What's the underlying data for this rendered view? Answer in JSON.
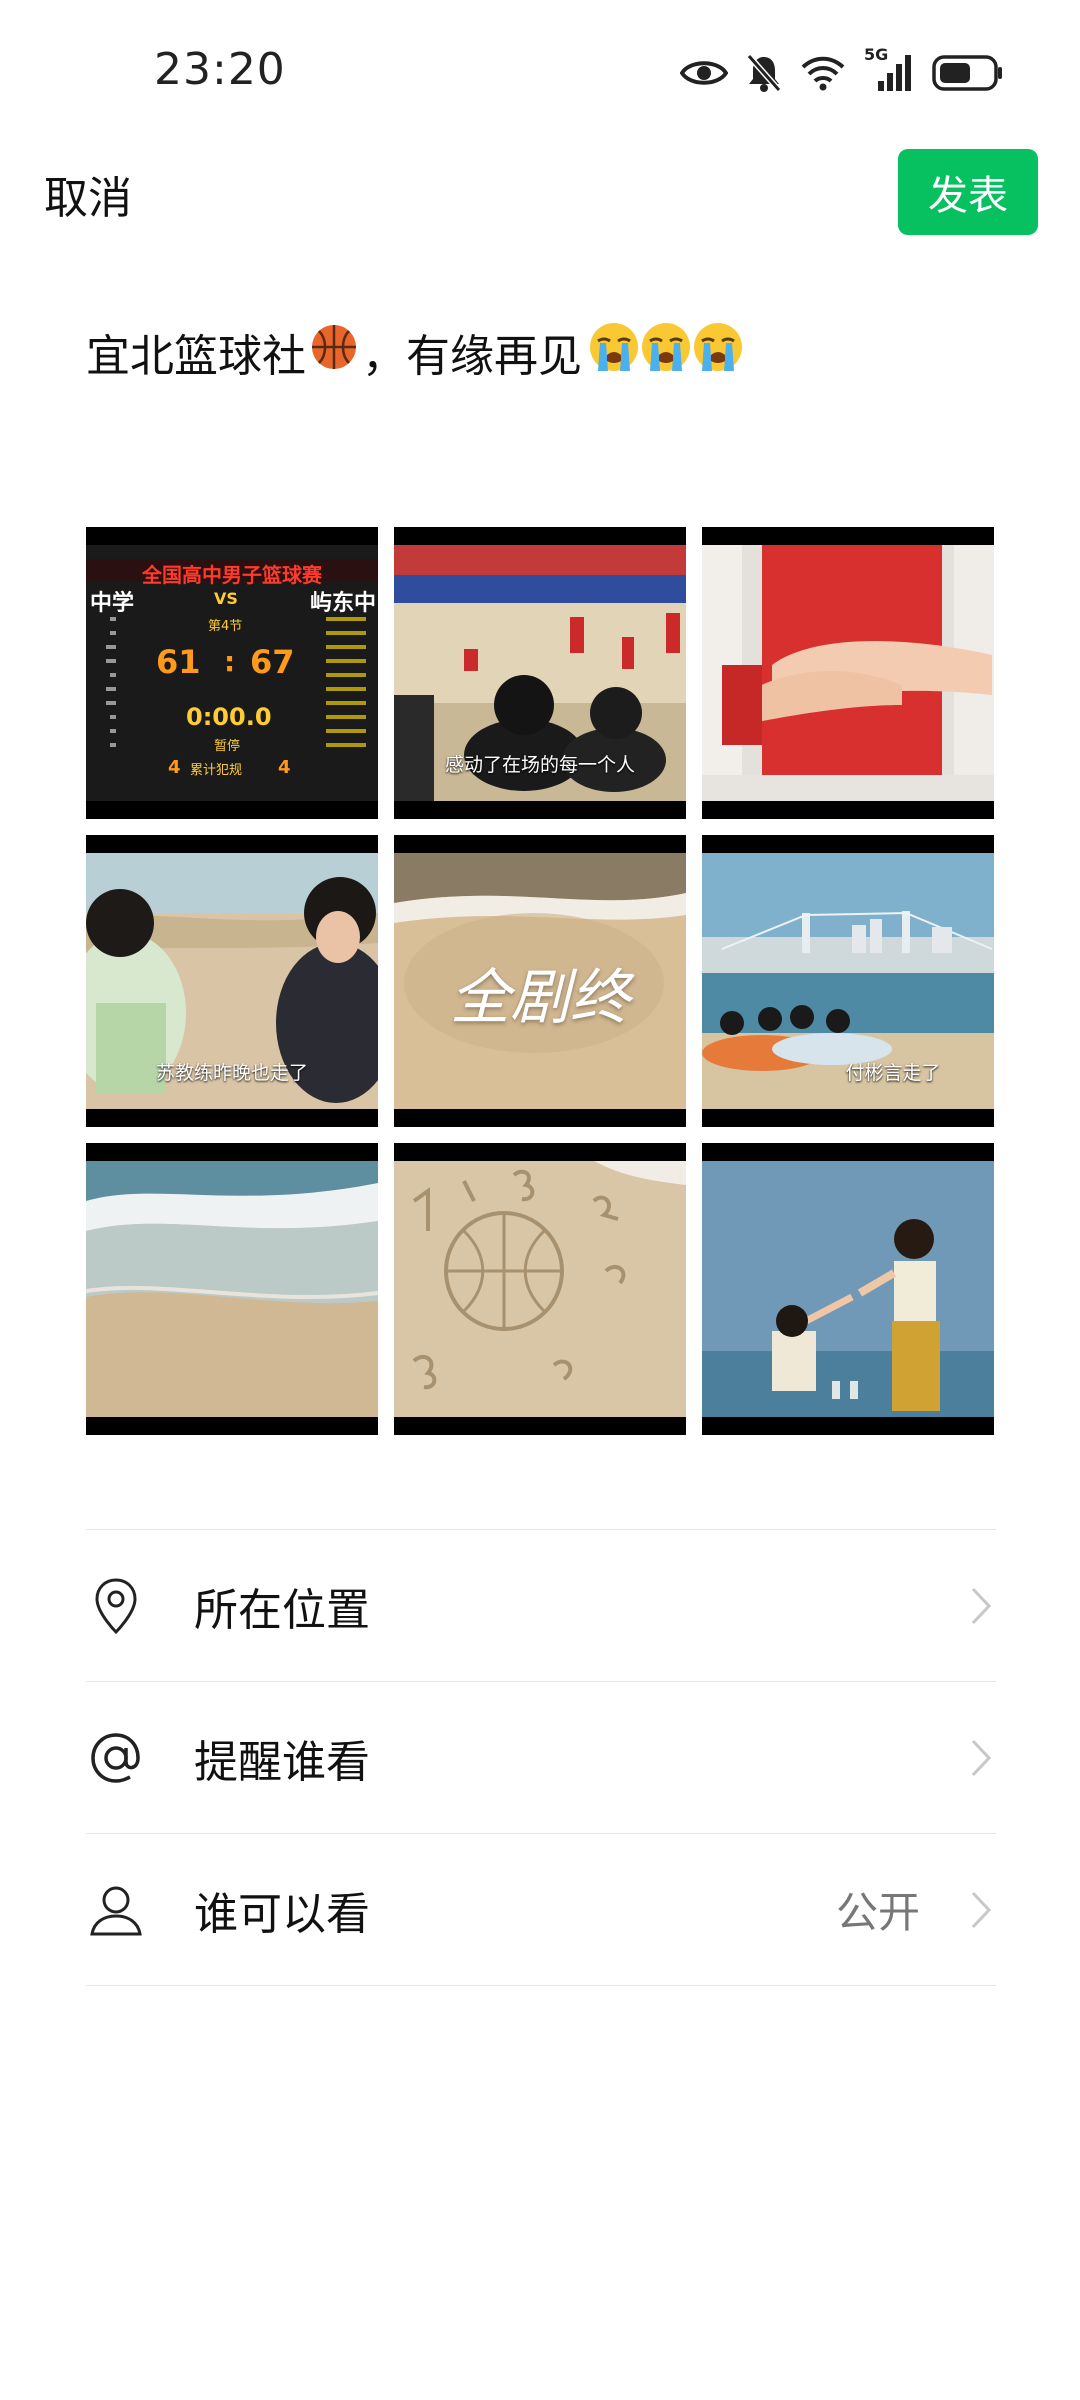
{
  "status_bar": {
    "time": "23:20",
    "network": "5G",
    "icons": [
      "eye-icon",
      "mute-bell-icon",
      "wifi-icon",
      "signal-icon",
      "battery-icon"
    ]
  },
  "header": {
    "cancel_label": "取消",
    "publish_label": "发表"
  },
  "post": {
    "text": "宜北篮球社",
    "text_after_ball": "，有缘再见"
  },
  "photos": [
    {
      "scoreboard_title": "全国高中男子篮球赛",
      "team_left": "中学",
      "vs": "VS",
      "team_right": "屿东中",
      "period": "第4节",
      "score_left": "61",
      "score_sep": ":",
      "score_right": "67",
      "clock": "0:00.0",
      "pause": "暂停",
      "fouls_left": "4",
      "fouls_label": "累计犯规",
      "fouls_right": "4"
    },
    {
      "caption": "感动了在场的每一个人"
    },
    {
      "caption": ""
    },
    {
      "caption": "苏教练昨晚也走了"
    },
    {
      "title": "全剧终"
    },
    {
      "caption": "付彬言走了"
    },
    {
      "caption": ""
    },
    {
      "caption": ""
    },
    {
      "caption": ""
    }
  ],
  "settings": [
    {
      "label": "所在位置",
      "icon": "location-pin-icon",
      "value": ""
    },
    {
      "label": "提醒谁看",
      "icon": "at-sign-icon",
      "value": ""
    },
    {
      "label": "谁可以看",
      "icon": "person-icon",
      "value": "公开"
    }
  ],
  "colors": {
    "accent": "#07c160",
    "divider": "#e8e8e8",
    "chevron": "#c8c8c8"
  }
}
